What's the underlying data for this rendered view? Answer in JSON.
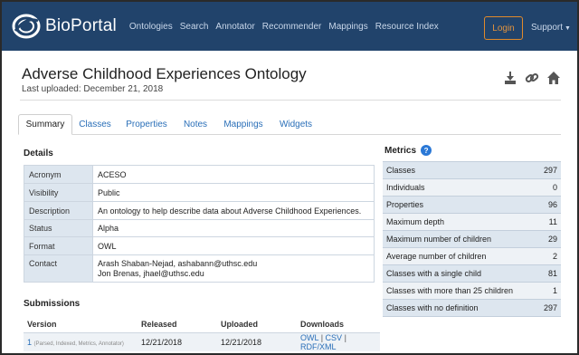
{
  "brand": {
    "name": "BioPortal"
  },
  "nav": {
    "links": [
      "Ontologies",
      "Search",
      "Annotator",
      "Recommender",
      "Mappings",
      "Resource Index"
    ],
    "login": "Login",
    "support": "Support"
  },
  "page": {
    "title": "Adverse Childhood Experiences Ontology",
    "subtitle": "Last uploaded: December 21, 2018",
    "icons": [
      "download-icon",
      "link-icon",
      "home-icon"
    ]
  },
  "tabs": [
    "Summary",
    "Classes",
    "Properties",
    "Notes",
    "Mappings",
    "Widgets"
  ],
  "active_tab": "Summary",
  "details": {
    "title": "Details",
    "rows": [
      {
        "key": "Acronym",
        "value": "ACESO"
      },
      {
        "key": "Visibility",
        "value": "Public"
      },
      {
        "key": "Description",
        "value": "An ontology to help describe data about Adverse Childhood Experiences."
      },
      {
        "key": "Status",
        "value": "Alpha"
      },
      {
        "key": "Format",
        "value": "OWL"
      },
      {
        "key": "Contact",
        "value": "Arash Shaban-Nejad,  ashabann@uthsc.edu",
        "value2": "Jon Brenas, jhael@uthsc.edu"
      }
    ]
  },
  "metrics": {
    "title": "Metrics",
    "rows": [
      {
        "label": "Classes",
        "value": "297"
      },
      {
        "label": "Individuals",
        "value": "0"
      },
      {
        "label": "Properties",
        "value": "96"
      },
      {
        "label": "Maximum depth",
        "value": "11"
      },
      {
        "label": "Maximum number of children",
        "value": "29"
      },
      {
        "label": "Average number of children",
        "value": "2"
      },
      {
        "label": "Classes with a single child",
        "value": "81"
      },
      {
        "label": "Classes with more than 25 children",
        "value": "1"
      },
      {
        "label": "Classes with no definition",
        "value": "297"
      }
    ]
  },
  "submissions": {
    "title": "Submissions",
    "headers": [
      "Version",
      "Released",
      "Uploaded",
      "Downloads"
    ],
    "row": {
      "version": "1",
      "status": "(Parsed, Indexed, Metrics, Annotator)",
      "released": "12/21/2018",
      "uploaded": "12/21/2018",
      "downloads": [
        "OWL",
        "CSV",
        "RDF/XML"
      ]
    }
  },
  "colors": {
    "navbar": "#21436b",
    "accent_link": "#2a6fb8",
    "login_border": "#e08a2b",
    "table_key_bg": "#dde6ef"
  }
}
